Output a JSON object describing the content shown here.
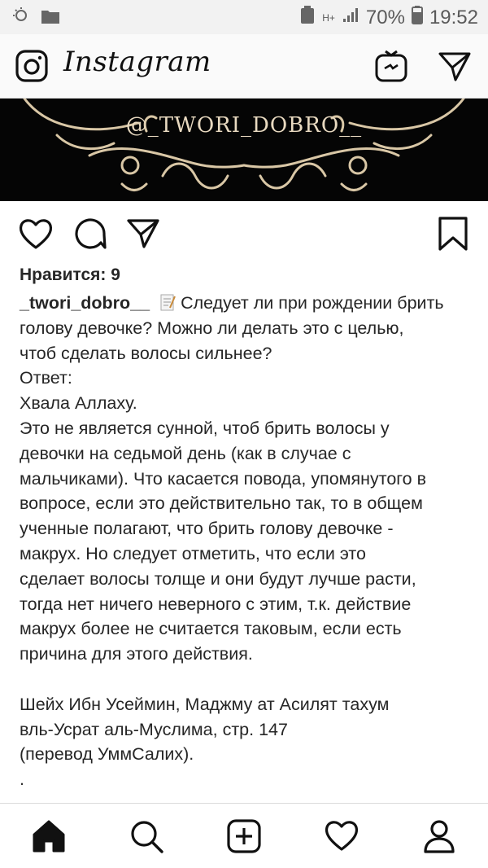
{
  "status_bar": {
    "battery": "70%",
    "time": "19:52",
    "network": "H+"
  },
  "header": {
    "logo": "Instagram"
  },
  "banner": {
    "handle": "@_TWORI_DOBRO__"
  },
  "post": {
    "likes_label": "Нравится: 9",
    "username": "_twori_dobro__",
    "caption_first": "Следует ли при рождении брить",
    "caption_rest": "голову девочке? Можно ли делать это с целью,\nчтоб сделать волосы сильнее?\nОтвет:\nХвала Аллаху.\nЭто не является сунной, чтоб брить волосы у\nдевочки на седьмой день (как в случае с\nмальчиками). Что касается повода, упомянутого в\nвопросе, если это действительно так, то в общем\nученные полагают, что брить голову девочке -\nмакрух. Но следует отметить, что если это\nсделает волосы толще и они будут лучше расти,\nтогда нет ничего неверного с этим, т.к. действие\nмакрух более не считается таковым, если есть\nпричина для этого действия.\n\nШейх Ибн Усеймин, Маджму ат Асилят тахум\nвль-Усрат аль-Муслима, стр. 147\n(перевод УммСалих).\n."
  },
  "icons": {
    "header": [
      "camera-icon",
      "igtv-icon",
      "direct-message-icon"
    ],
    "actions": [
      "heart-icon",
      "comment-icon",
      "share-icon",
      "bookmark-icon"
    ],
    "nav": [
      "home-icon",
      "search-icon",
      "new-post-icon",
      "activity-icon",
      "profile-icon"
    ]
  },
  "colors": {
    "text": "#262626",
    "banner_bg": "#050505",
    "banner_ornament": "#e8d9c0"
  }
}
